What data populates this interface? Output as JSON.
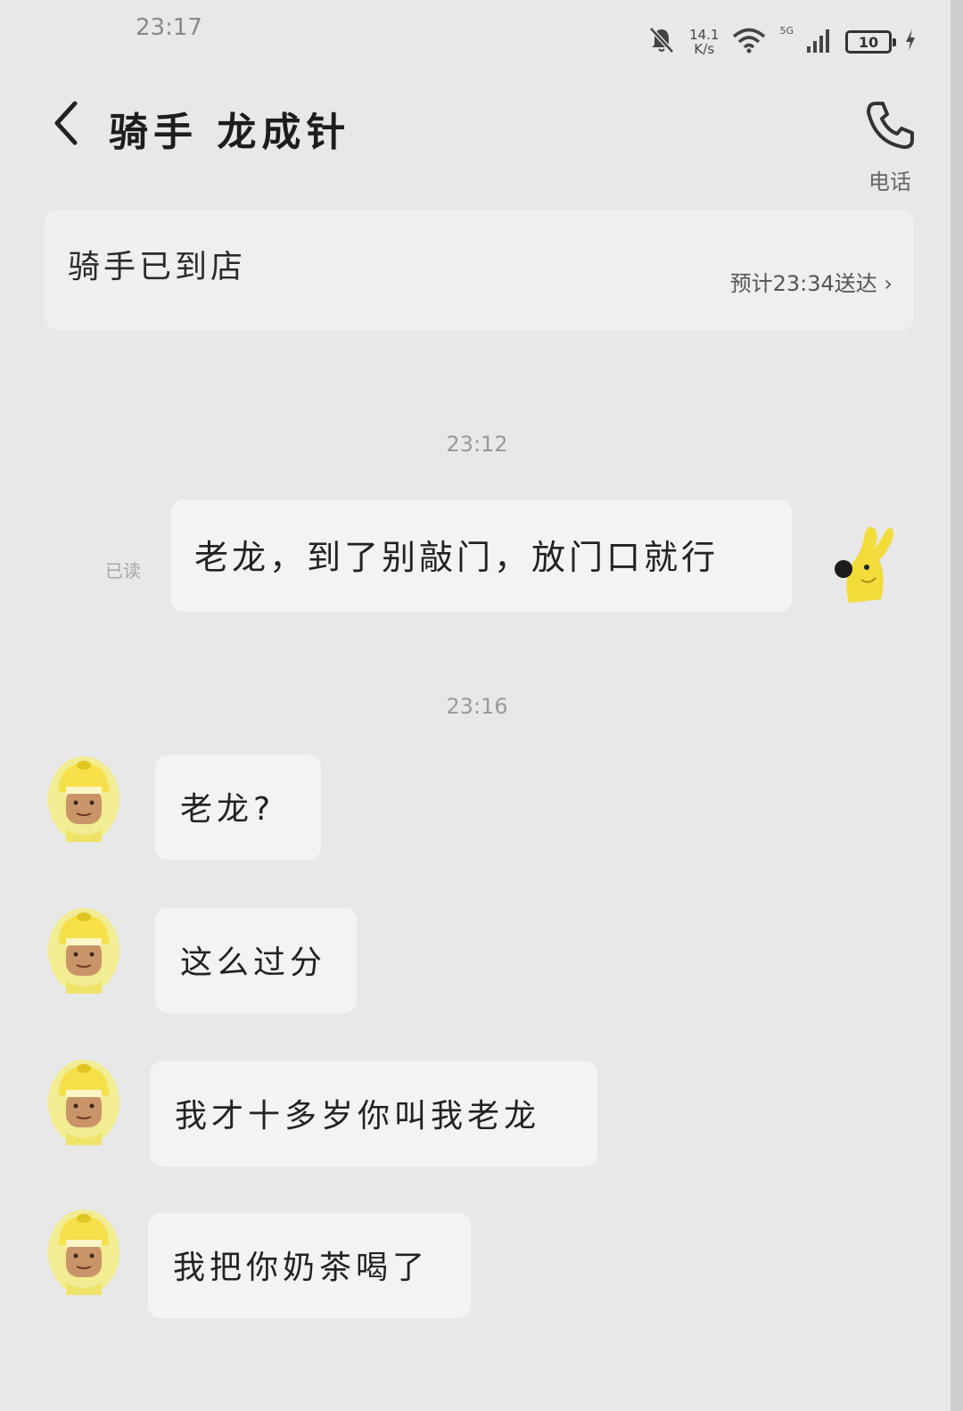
{
  "status_bar": {
    "time": "23:17",
    "net_speed_value": "14.1",
    "net_speed_unit": "K/s",
    "signal_type": "5G",
    "battery": "10"
  },
  "header": {
    "title": "骑手 龙成针",
    "phone_label": "电话"
  },
  "order_card": {
    "status": "骑手已到店",
    "eta": "预计23:34送达 ›"
  },
  "timestamps": [
    "23:12",
    "23:16"
  ],
  "my_message": {
    "text": "老龙，到了别敲门，放门口就行",
    "read_status": "已读"
  },
  "rider_messages": [
    {
      "text": "老龙?"
    },
    {
      "text": "这么过分"
    },
    {
      "text": "我才十多岁你叫我老龙"
    },
    {
      "text": "我把你奶茶喝了"
    }
  ],
  "colors": {
    "background": "#e8e8e8",
    "bubble": "#f3f3f3",
    "avatar_yellow": "#f2dc3a",
    "helmet_yellow": "#f6e04a"
  }
}
